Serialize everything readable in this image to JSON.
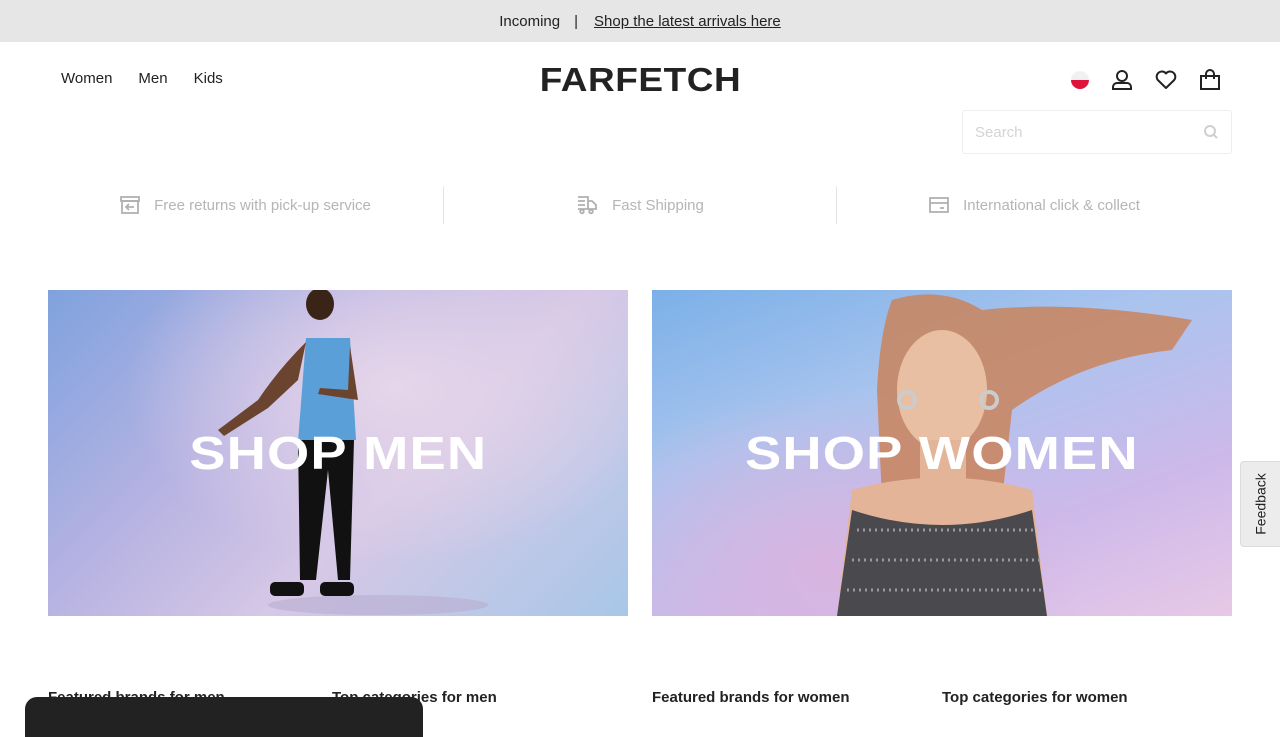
{
  "announcement": {
    "prefix": "Incoming",
    "separator": "|",
    "link_text": "Shop the latest arrivals here"
  },
  "header": {
    "logo": "FARFETCH",
    "nav": [
      "Women",
      "Men",
      "Kids"
    ],
    "icons": [
      "country-flag-poland",
      "account-icon",
      "wishlist-icon",
      "bag-icon"
    ],
    "search": {
      "placeholder": "Search",
      "value": ""
    }
  },
  "usps": [
    {
      "icon": "returns-icon",
      "label": "Free returns with pick-up service"
    },
    {
      "icon": "shipping-icon",
      "label": "Fast Shipping"
    },
    {
      "icon": "click-collect-icon",
      "label": "International click & collect"
    }
  ],
  "heroes": [
    {
      "title": "SHOP MEN"
    },
    {
      "title": "SHOP WOMEN"
    }
  ],
  "footer_columns": [
    "Featured brands for men",
    "Top categories for men",
    "Featured brands for women",
    "Top categories for women"
  ],
  "feedback_tab": "Feedback",
  "colors": {
    "announcement_bg": "#e6e6e6",
    "text": "#222222",
    "usp_text": "#b5b5b5",
    "flag_red": "#dc143c"
  }
}
